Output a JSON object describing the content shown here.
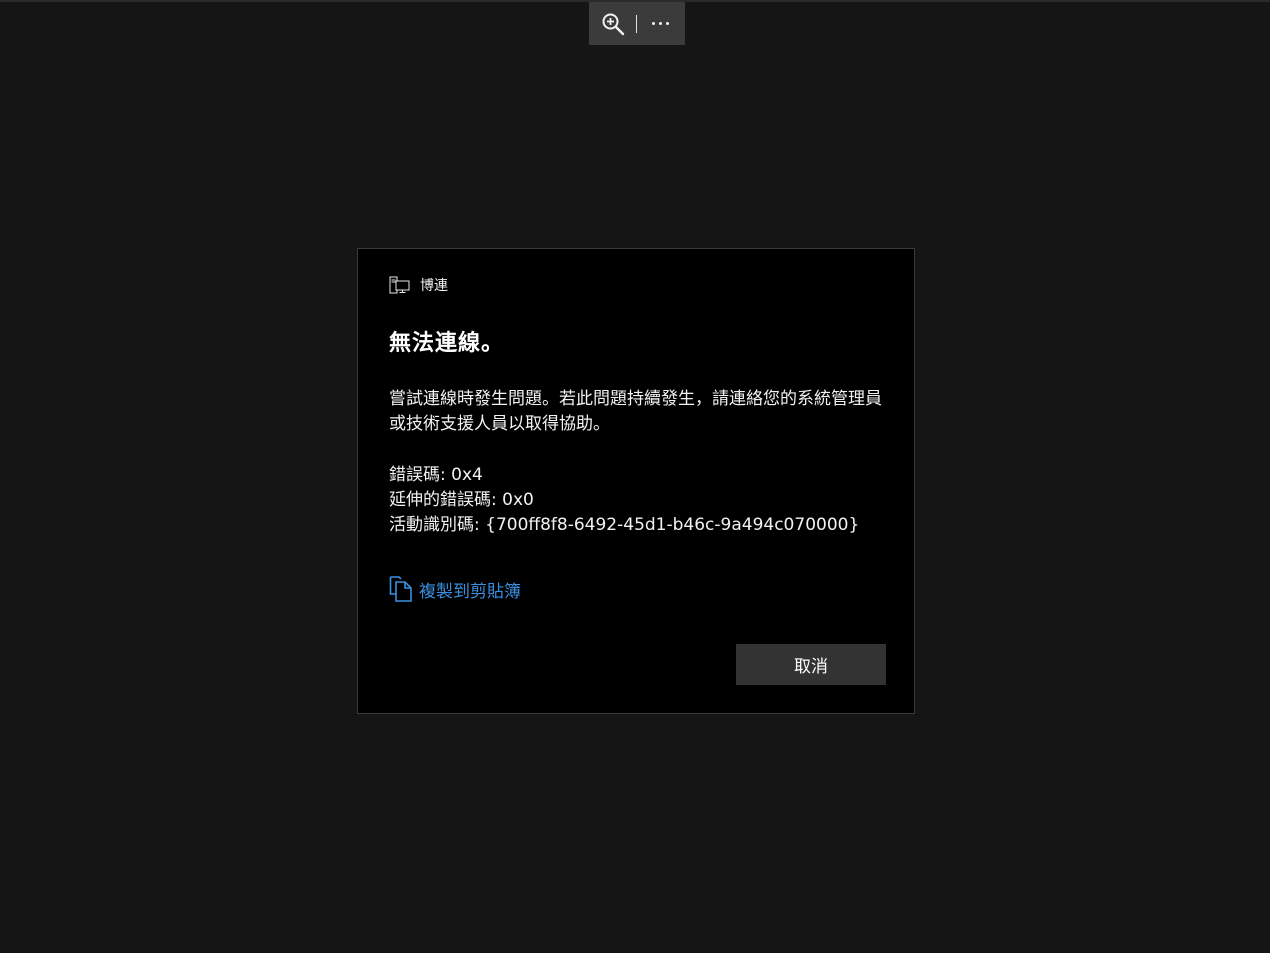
{
  "toolbar": {
    "zoom_icon": "zoom-in-icon",
    "more_icon": "more-icon"
  },
  "dialog": {
    "app_icon": "remote-desktop-icon",
    "app_name": "博連",
    "title": "無法連線。",
    "description": "嘗試連線時發生問題。若此問題持續發生，請連絡您的系統管理員或技術支援人員以取得協助。",
    "error_code": "錯誤碼: 0x4",
    "extended_error_code": "延伸的錯誤碼: 0x0",
    "activity_id": "活動識別碼: {700ff8f8-6492-45d1-b46c-9a494c070000}",
    "copy_icon": "copy-icon",
    "copy_label": "複製到剪貼簿",
    "cancel_label": "取消"
  },
  "colors": {
    "background": "#151515",
    "dialog": "#000000",
    "link": "#3a8fe0",
    "button": "#333333",
    "toolbar": "#3b3b3b"
  }
}
